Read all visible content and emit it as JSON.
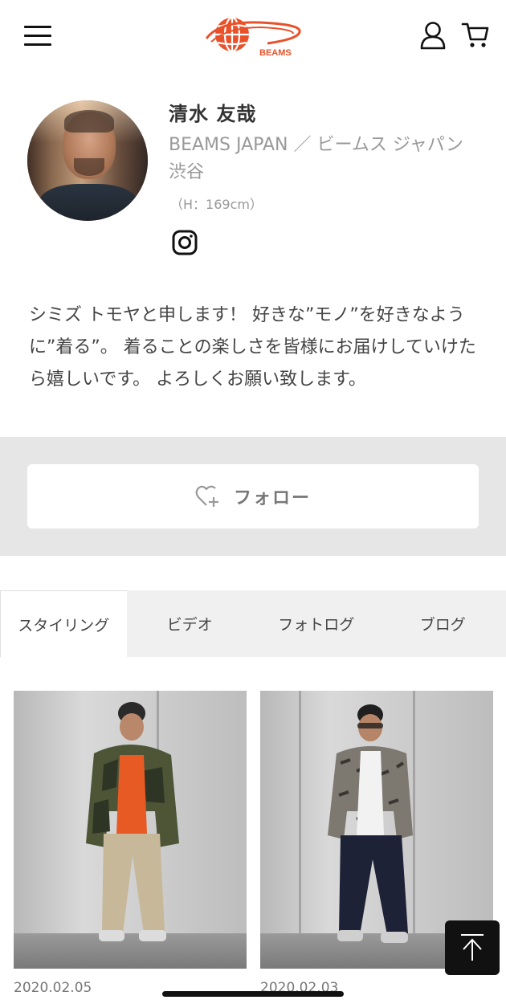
{
  "header": {
    "logo_text": "BEAMS",
    "menu_icon": "hamburger-menu-icon",
    "account_icon": "user-icon",
    "cart_icon": "cart-icon"
  },
  "profile": {
    "name": "清水 友哉",
    "store": "BEAMS JAPAN ／ ビームス ジャパン 渋谷",
    "height": "（H：169cm）",
    "social_icon": "instagram-icon",
    "bio": "シミズ トモヤと申します！ 好きな”モノ”を好きなように”着る”。 着ることの楽しさを皆様にお届けしていけたら嬉しいです。 よろしくお願い致します。"
  },
  "follow": {
    "label": "フォロー",
    "icon": "heart-plus-icon"
  },
  "tabs": [
    {
      "label": "スタイリング",
      "active": true
    },
    {
      "label": "ビデオ",
      "active": false
    },
    {
      "label": "フォトログ",
      "active": false
    },
    {
      "label": "ブログ",
      "active": false
    }
  ],
  "stylings": [
    {
      "date": "2020.02.05"
    },
    {
      "date": "2020.02.03"
    }
  ],
  "colors": {
    "brand": "#e8512a",
    "follow_panel_bg": "#e6e6e6",
    "tab_bg": "#f0f0f0",
    "muted_text": "#999999"
  },
  "scroll_top_icon": "arrow-up-to-top-icon"
}
